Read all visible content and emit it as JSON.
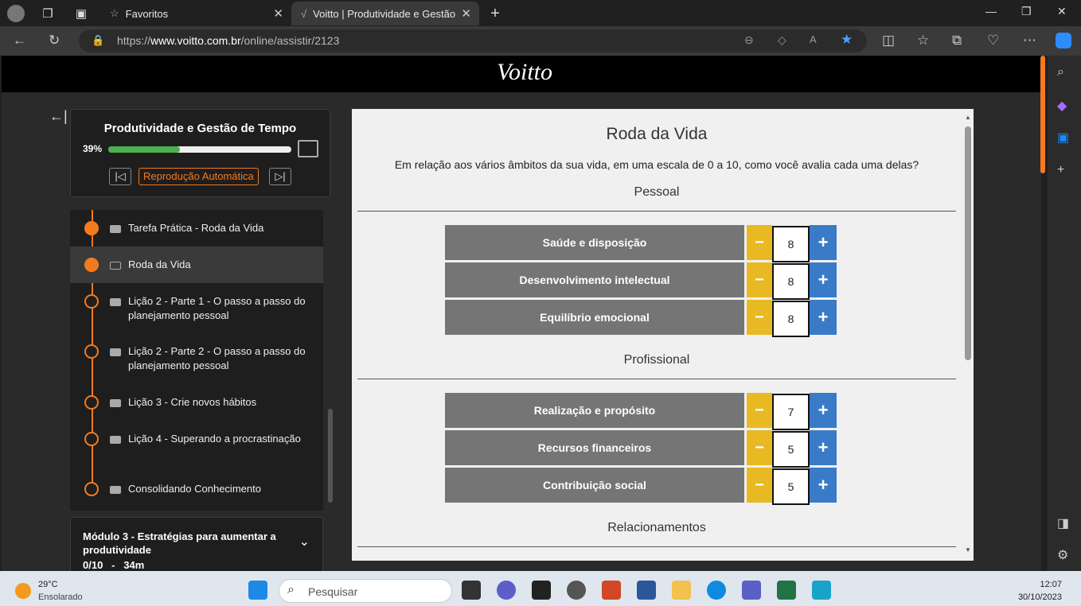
{
  "browser": {
    "tabs": [
      {
        "label": "Favoritos"
      },
      {
        "label": "Voitto | Produtividade e Gestão d"
      }
    ],
    "url_prefix": "https://",
    "url_domain": "www.voitto.com.br",
    "url_path": "/online/assistir/2123"
  },
  "site": {
    "logo": "Voitto"
  },
  "course": {
    "title": "Produtividade e Gestão de Tempo",
    "progress_label": "39%",
    "progress": 0.39,
    "autoplay_label": "Reprodução Automática"
  },
  "lessons": [
    {
      "title": "Tarefa Prática - Roda da Vida",
      "done": true,
      "icon": "video-icon"
    },
    {
      "title": "Roda da Vida",
      "done": true,
      "selected": true,
      "icon": "monitor-icon"
    },
    {
      "title": "Lição 2 - Parte 1 - O passo a passo do planejamento pessoal",
      "icon": "video-icon"
    },
    {
      "title": "Lição 2 - Parte 2 - O passo a passo do planejamento pessoal",
      "icon": "video-icon"
    },
    {
      "title": "Lição 3 - Crie novos hábitos",
      "icon": "video-icon"
    },
    {
      "title": "Lição 4 - Superando a procrastinação",
      "icon": "video-icon"
    },
    {
      "title": "Consolidando Conhecimento",
      "icon": "video-icon"
    }
  ],
  "module": {
    "title": "Módulo 3 - Estratégias para aumentar a produtividade",
    "meta": "0/10   -   34m"
  },
  "content": {
    "title": "Roda da Vida",
    "question": "Em relação aos vários âmbitos da sua vida, em uma escala de 0 a 10, como você avalia cada uma delas?",
    "minus": "−",
    "plus": "+",
    "sections": [
      {
        "name": "Pessoal",
        "items": [
          {
            "label": "Saúde e disposição",
            "value": "8"
          },
          {
            "label": "Desenvolvimento intelectual",
            "value": "8"
          },
          {
            "label": "Equilíbrio emocional",
            "value": "8"
          }
        ]
      },
      {
        "name": "Profissional",
        "items": [
          {
            "label": "Realização e propósito",
            "value": "7"
          },
          {
            "label": "Recursos financeiros",
            "value": "5"
          },
          {
            "label": "Contribuição social",
            "value": "5"
          }
        ]
      },
      {
        "name": "Relacionamentos",
        "items": []
      }
    ]
  },
  "taskbar": {
    "temperature": "29°C",
    "condition": "Ensolarado",
    "search_placeholder": "Pesquisar",
    "time": "12:07",
    "date": "30/10/2023"
  },
  "colors": {
    "accent": "#f47a20",
    "minus": "#e8b923",
    "plus": "#3a7bc8",
    "progress": "#4caf50"
  }
}
